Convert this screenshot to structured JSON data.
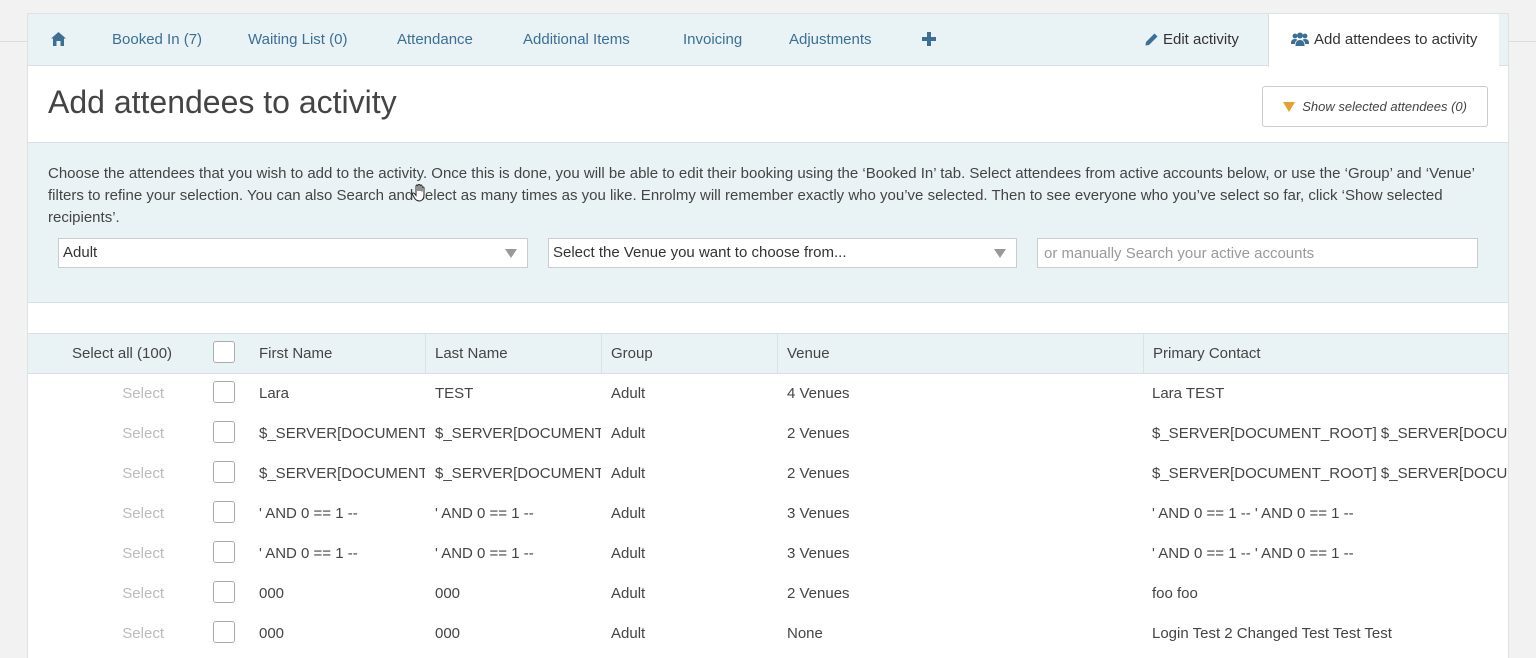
{
  "tabs": {
    "home_icon": "home-icon",
    "booked_in": "Booked In (7)",
    "waiting_list": "Waiting List (0)",
    "attendance": "Attendance",
    "additional_items": "Additional Items",
    "invoicing": "Invoicing",
    "adjustments": "Adjustments",
    "add_icon": "plus-icon",
    "edit_activity": "Edit activity",
    "add_attendees": "Add attendees to activity"
  },
  "page": {
    "title": "Add attendees to activity",
    "show_selected": "Show selected attendees (0)"
  },
  "filters": {
    "description": "Choose the attendees that you wish to add to the activity. Once this is done, you will be able to edit their booking using the ‘Booked In’ tab. Select attendees from active accounts below, or use the ‘Group’ and ‘Venue’ filters to refine your selection. You can also Search and select as many times as you like. Enrolmy will remember exactly who you’ve selected. Then to see everyone who you’ve select so far, click ‘Show selected recipients’.",
    "group_value": "Adult",
    "venue_value": "Select the Venue you want to choose from...",
    "search_placeholder": "or manually Search your active accounts"
  },
  "table": {
    "select_all": "Select all (100)",
    "headers": {
      "first_name": "First Name",
      "last_name": "Last Name",
      "group": "Group",
      "venue": "Venue",
      "primary_contact": "Primary Contact"
    },
    "select_label": "Select",
    "rows": [
      {
        "first": "Lara",
        "last": "TEST",
        "group": "Adult",
        "venue": "4 Venues",
        "contact": "Lara TEST"
      },
      {
        "first": "$_SERVER[DOCUMENT_ROOT]",
        "last": "$_SERVER[DOCUMENT_ROOT]",
        "group": "Adult",
        "venue": "2 Venues",
        "contact": "$_SERVER[DOCUMENT_ROOT] $_SERVER[DOCUMENT_ROOT]"
      },
      {
        "first": "$_SERVER[DOCUMENT_ROOT]",
        "last": "$_SERVER[DOCUMENT_ROOT]",
        "group": "Adult",
        "venue": "2 Venues",
        "contact": "$_SERVER[DOCUMENT_ROOT] $_SERVER[DOCUMENT_ROOT]"
      },
      {
        "first": "' AND 0 == 1 --",
        "last": "' AND 0 == 1 --",
        "group": "Adult",
        "venue": "3 Venues",
        "contact": "' AND 0 == 1 -- ' AND 0 == 1 --"
      },
      {
        "first": "' AND 0 == 1 --",
        "last": "' AND 0 == 1 --",
        "group": "Adult",
        "venue": "3 Venues",
        "contact": "' AND 0 == 1 -- ' AND 0 == 1 --"
      },
      {
        "first": "000",
        "last": "000",
        "group": "Adult",
        "venue": "2 Venues",
        "contact": "foo foo"
      },
      {
        "first": "000",
        "last": "000",
        "group": "Adult",
        "venue": "None",
        "contact": "Login Test 2 Changed Test Test Test"
      }
    ]
  },
  "colors": {
    "tab_link": "#3b6f96",
    "tab_bar_bg": "#e9f3f5",
    "funnel": "#e3a22b"
  }
}
